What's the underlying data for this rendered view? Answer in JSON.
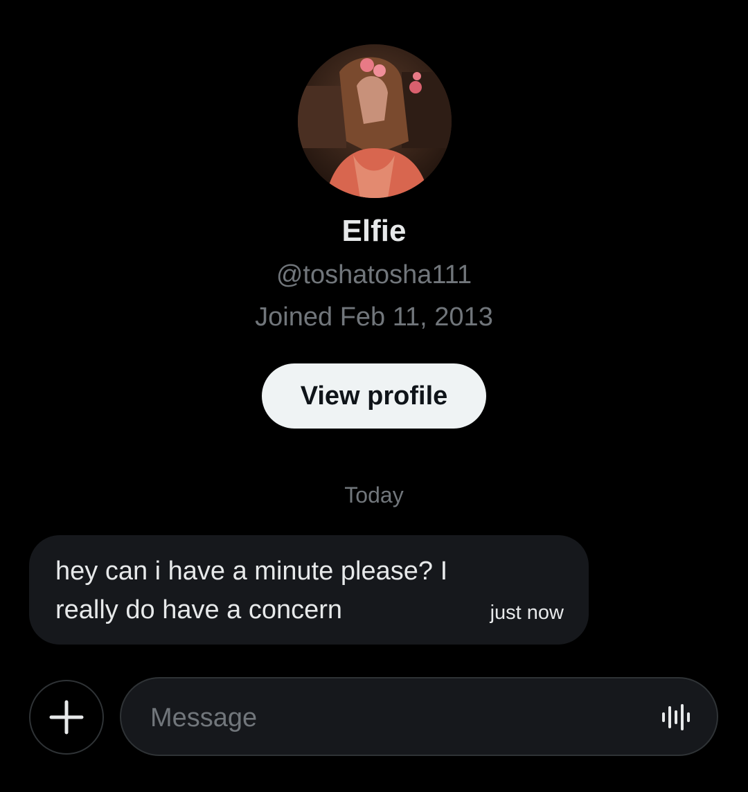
{
  "profile": {
    "display_name": "Elfie",
    "handle": "@toshatosha111",
    "joined": "Joined Feb 11, 2013",
    "view_profile_label": "View profile"
  },
  "conversation": {
    "day_label": "Today",
    "messages": [
      {
        "text": "hey can i have a minute please? I really do have a concern",
        "time": "just now"
      }
    ]
  },
  "composer": {
    "placeholder": "Message",
    "value": "",
    "add_icon": "plus-icon",
    "voice_icon": "audio-waveform-icon"
  },
  "colors": {
    "background": "#000000",
    "primary_text": "#e7e9ea",
    "secondary_text": "#71767b",
    "bubble": "#16181c",
    "button_bg": "#eff3f4",
    "button_text": "#0f1419",
    "border": "#2f3336"
  }
}
